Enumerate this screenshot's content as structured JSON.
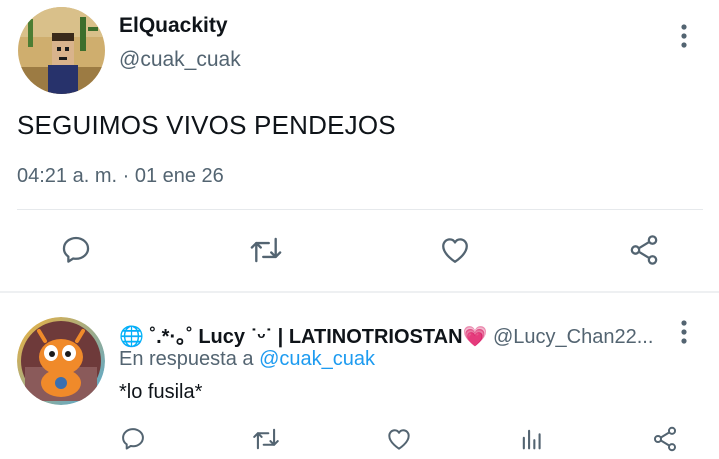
{
  "tweet": {
    "display_name": "ElQuackity",
    "handle": "@cuak_cuak",
    "text": "SEGUIMOS VIVOS PENDEJOS",
    "timestamp": "04:21 a. m. · 01 ene 26"
  },
  "actions": [
    "reply-icon",
    "retweet-icon",
    "like-icon",
    "share-icon"
  ],
  "reply": {
    "globe": "🌐",
    "display_name": "˚.*·｡˚ Lucy ˙ᵕ˙ | LATINOTRIOSTAN💗",
    "handle": "@Lucy_Chan22...",
    "reply_prefix": "En respuesta a",
    "reply_mention": "@cuak_cuak",
    "text": "*lo fusila*"
  },
  "reply_actions": [
    "reply-icon",
    "retweet-icon",
    "like-icon",
    "views-icon",
    "share-icon"
  ],
  "colors": {
    "primary_text": "#0f1419",
    "secondary_text": "#536471",
    "link": "#1d9bf0",
    "divider": "#e6e9ec"
  }
}
